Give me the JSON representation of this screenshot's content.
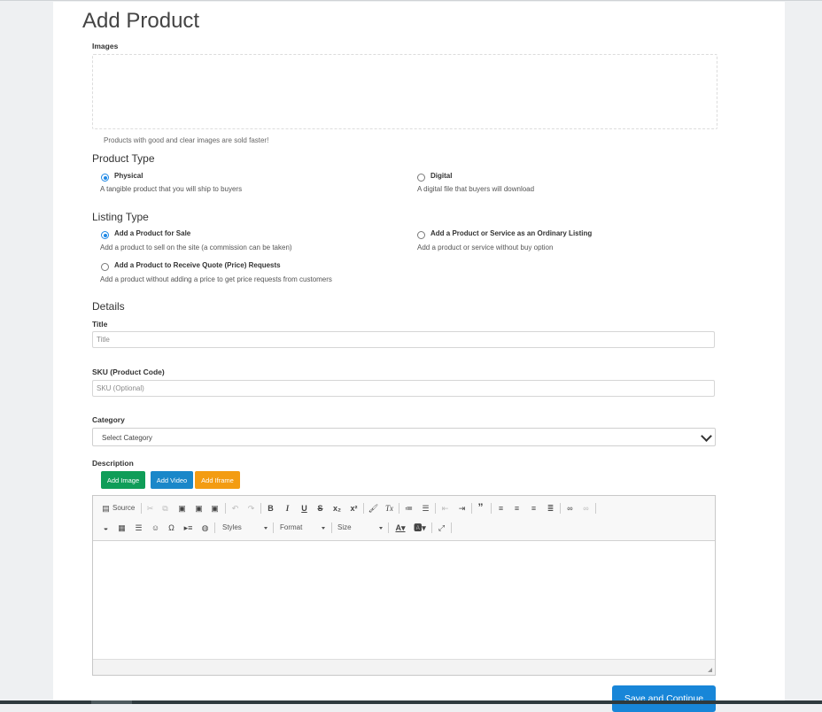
{
  "page": {
    "title": "Add Product"
  },
  "images": {
    "label": "Images",
    "hint": "Products with good and clear images are sold faster!"
  },
  "product_type": {
    "heading": "Product Type",
    "options": [
      {
        "label": "Physical",
        "desc": "A tangible product that you will ship to buyers",
        "selected": true
      },
      {
        "label": "Digital",
        "desc": "A digital file that buyers will download",
        "selected": false
      }
    ]
  },
  "listing_type": {
    "heading": "Listing Type",
    "options": [
      {
        "label": "Add a Product for Sale",
        "desc": "Add a product to sell on the site (a commission can be taken)",
        "selected": true
      },
      {
        "label": "Add a Product or Service as an Ordinary Listing",
        "desc": "Add a product or service without buy option",
        "selected": false
      },
      {
        "label": "Add a Product to Receive Quote (Price) Requests",
        "desc": "Add a product without adding a price to get price requests from customers",
        "selected": false
      }
    ]
  },
  "details": {
    "heading": "Details",
    "title_label": "Title",
    "title_placeholder": "Title",
    "sku_label": "SKU (Product Code)",
    "sku_placeholder": "SKU (Optional)",
    "category_label": "Category",
    "category_value": "Select Category",
    "description_label": "Description"
  },
  "media_buttons": {
    "add_image": "Add Image",
    "add_video": "Add Video",
    "add_iframe": "Add Iframe"
  },
  "editor": {
    "source_label": "Source",
    "styles_label": "Styles",
    "format_label": "Format",
    "size_label": "Size"
  },
  "save_button": "Save and Continue",
  "colors": {
    "primary": "#1886d8",
    "green": "#0f9d58",
    "blue": "#1a87c9",
    "orange": "#f39c12"
  }
}
